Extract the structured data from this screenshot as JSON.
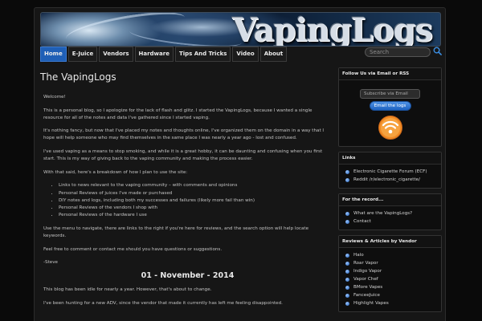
{
  "site": {
    "logo_text": "VapingLogs"
  },
  "nav": {
    "items": [
      {
        "label": "Home",
        "active": true
      },
      {
        "label": "E-Juice",
        "active": false
      },
      {
        "label": "Vendors",
        "active": false
      },
      {
        "label": "Hardware",
        "active": false
      },
      {
        "label": "Tips And Tricks",
        "active": false
      },
      {
        "label": "Video",
        "active": false
      },
      {
        "label": "About",
        "active": false
      }
    ]
  },
  "search": {
    "placeholder": "Search"
  },
  "main": {
    "title": "The VapingLogs",
    "p_welcome": "Welcome!",
    "p1": "This is a personal blog, so I apologize for the lack of flash and glitz. I started the VapingLogs, because I wanted a single resource for all of the notes and data I've gathered since I started vaping.",
    "p2": "It's nothing fancy, but now that I've placed my notes and thoughts online, I've organized them on the domain in a way that I hope will help someone who may find themselves in the same place I was nearly a year ago - lost and confused.",
    "p3": "I've used vaping as a means to stop smoking, and while it is a great hobby, it can be daunting and confusing when you first start. This is my way of giving back to the vaping community and making the process easier.",
    "p4": "With that said, here's a breakdown of how I plan to use the site:",
    "list": [
      "Links to news relevant to the vaping community – with comments and opinions",
      "Personal Reviews of juices I've made or purchased",
      "DIY notes and logs, including both my successes and failures (likely more fail than win)",
      "Personal Reviews of the vendors I shop with",
      "Personal Reviews of the hardware I use"
    ],
    "p5": "Use the menu to navigate, there are links to the right if you're here for reviews, and the search option will help locate keywords.",
    "p6": "Feel free to comment or contact me should you have questions or suggestions.",
    "signature": "-Steve",
    "post_date": "01 - November - 2014",
    "post_p1": "This blog has been idle for nearly a year. However, that's about to change.",
    "post_p2": "I've been hunting for a new ADV, since the vendor that made it currently has left me feeling disappointed."
  },
  "sidebar": {
    "follow": {
      "title": "Follow Us via Email or RSS",
      "input_placeholder": "Subscribe via Email",
      "button_label": "Email the logs"
    },
    "links": {
      "title": "Links",
      "items": [
        "Electronic Cigarette Forum (ECF)",
        "Reddit /r/electronic_cigarette/"
      ]
    },
    "record": {
      "title": "For the record...",
      "items": [
        "What are the VapingLogs?",
        "Contact"
      ]
    },
    "reviews": {
      "title": "Reviews & Articles by Vendor",
      "items": [
        "Halo",
        "Roar Vapor",
        "Indigo Vapor",
        "Vapor Chef",
        "BMore Vapes",
        "FanceeJuice",
        "Highlight Vapes"
      ]
    }
  },
  "colors": {
    "nav_active": "#1f5fb6",
    "email_button": "#2f78d6",
    "rss_orange": "#f08a24"
  }
}
